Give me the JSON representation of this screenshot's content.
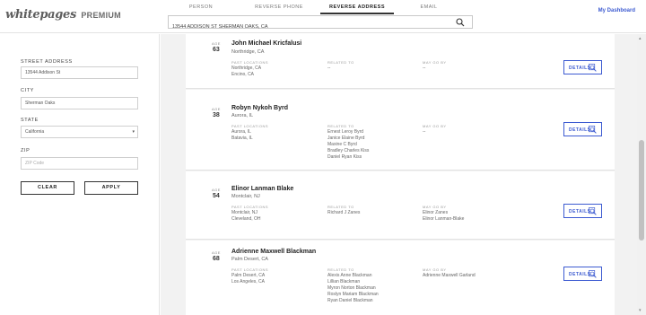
{
  "header": {
    "logo_brand": "whitepages",
    "logo_suffix": "PREMIUM",
    "tabs": [
      {
        "label": "PERSON"
      },
      {
        "label": "REVERSE PHONE"
      },
      {
        "label": "REVERSE ADDRESS"
      },
      {
        "label": "EMAIL"
      }
    ],
    "active_tab": "REVERSE ADDRESS",
    "search_value": "13544 ADDISON ST SHERMAN OAKS, CA",
    "dashboard_link": "My Dashboard"
  },
  "sidebar": {
    "street_label": "STREET ADDRESS",
    "street_value": "13544 Addison St",
    "city_label": "CITY",
    "city_value": "Sherman Oaks",
    "state_label": "STATE",
    "state_value": "California",
    "zip_label": "ZIP",
    "zip_placeholder": "ZIP Code",
    "clear_label": "CLEAR",
    "apply_label": "APPLY"
  },
  "results": {
    "age_label": "AGE",
    "past_locations_label": "PAST LOCATIONS",
    "related_to_label": "RELATED TO",
    "may_go_by_label": "MAY GO BY",
    "details_label": "DETAILS",
    "people": [
      {
        "age": "63",
        "name": "John Michael Kricfalusi",
        "location": "Northridge, CA",
        "past_locations": [
          "Northridge, CA",
          "Encino, CA"
        ],
        "related_to": [
          "--"
        ],
        "may_go_by": [
          "--"
        ]
      },
      {
        "age": "38",
        "name": "Robyn Nykoh Byrd",
        "location": "Aurora, IL",
        "past_locations": [
          "Aurora, IL",
          "Batavia, IL"
        ],
        "related_to": [
          "Ernest Leroy Byrd",
          "Janice Elaine Byrd",
          "Maxine C Byrd",
          "Bradley Charles Kiss",
          "Daniel Ryan Kiss"
        ],
        "may_go_by": [
          "--"
        ]
      },
      {
        "age": "54",
        "name": "Elinor Lanman Blake",
        "location": "Montclair, NJ",
        "past_locations": [
          "Montclair, NJ",
          "Cleveland, OH"
        ],
        "related_to": [
          "Richard J Zanes"
        ],
        "may_go_by": [
          "Elinor Zanes",
          "Elinor Lanman-Blake"
        ]
      },
      {
        "age": "68",
        "name": "Adrienne Maxwell Blackman",
        "location": "Palm Desert, CA",
        "past_locations": [
          "Palm Desert, CA",
          "Los Angeles, CA"
        ],
        "related_to": [
          "Alexis Anne Blackman",
          "Lillian Blackman",
          "Myron Norton Blackman",
          "Roslyn Mariam Blackman",
          "Ryan Daniel Blackman"
        ],
        "may_go_by": [
          "Adrienne Maxwell Garland"
        ]
      }
    ]
  },
  "colors": {
    "accent": "#3d5bd1",
    "main_bg": "#f2f2f2"
  }
}
